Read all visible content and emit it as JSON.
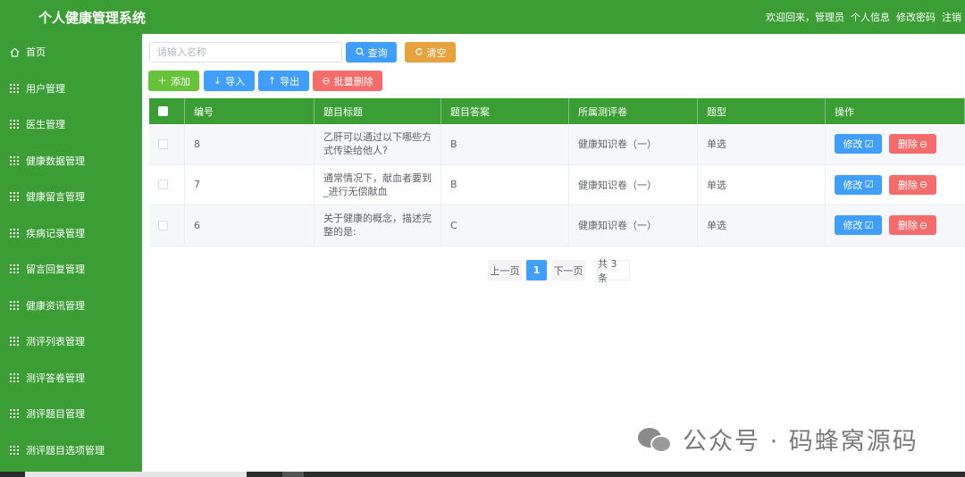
{
  "header": {
    "title": "个人健康管理系统",
    "welcome": "欢迎回来，管理员",
    "profile": "个人信息",
    "change_password": "修改密码",
    "logout": "注销"
  },
  "sidebar": {
    "items": [
      {
        "label": "首页",
        "icon": "home-icon"
      },
      {
        "label": "用户管理",
        "icon": "grid-icon"
      },
      {
        "label": "医生管理",
        "icon": "grid-icon"
      },
      {
        "label": "健康数据管理",
        "icon": "grid-icon"
      },
      {
        "label": "健康留言管理",
        "icon": "grid-icon"
      },
      {
        "label": "疾病记录管理",
        "icon": "grid-icon"
      },
      {
        "label": "留言回复管理",
        "icon": "grid-icon"
      },
      {
        "label": "健康资讯管理",
        "icon": "grid-icon"
      },
      {
        "label": "测评列表管理",
        "icon": "grid-icon"
      },
      {
        "label": "测评答卷管理",
        "icon": "grid-icon"
      },
      {
        "label": "测评题目管理",
        "icon": "grid-icon"
      },
      {
        "label": "测评题目选项管理",
        "icon": "grid-icon"
      }
    ]
  },
  "search": {
    "placeholder": "请输入名称",
    "value": "",
    "query_label": "查询",
    "clear_label": "清空"
  },
  "toolbar": {
    "add_label": "添加",
    "import_label": "导入",
    "export_label": "导出",
    "batch_delete_label": "批量删除"
  },
  "table": {
    "headers": [
      "编号",
      "题目标题",
      "题目答案",
      "所属测评卷",
      "题型",
      "操作"
    ],
    "rows": [
      {
        "id": "8",
        "title": "乙肝可以通过以下哪些方式传染给他人?",
        "answer": "B",
        "paper": "健康知识卷（一）",
        "type": "单选"
      },
      {
        "id": "7",
        "title": "通常情况下，献血者要到_进行无偿献血",
        "answer": "B",
        "paper": "健康知识卷（一）",
        "type": "单选"
      },
      {
        "id": "6",
        "title": "关于健康的概念，描述完整的是:",
        "answer": "C",
        "paper": "健康知识卷（一）",
        "type": "单选"
      }
    ],
    "edit_label": "修改",
    "delete_label": "删除"
  },
  "pagination": {
    "prev_label": "上一页",
    "current_page": "1",
    "next_label": "下一页",
    "total_label": "共 3 条"
  },
  "watermark": {
    "text": "公众号 · 码蜂窝源码"
  },
  "colors": {
    "brand_green": "#3a9e35",
    "primary_blue": "#409eff",
    "warning_orange": "#e6a23c",
    "success_green": "#67c23a",
    "danger_red": "#f56c6c"
  }
}
